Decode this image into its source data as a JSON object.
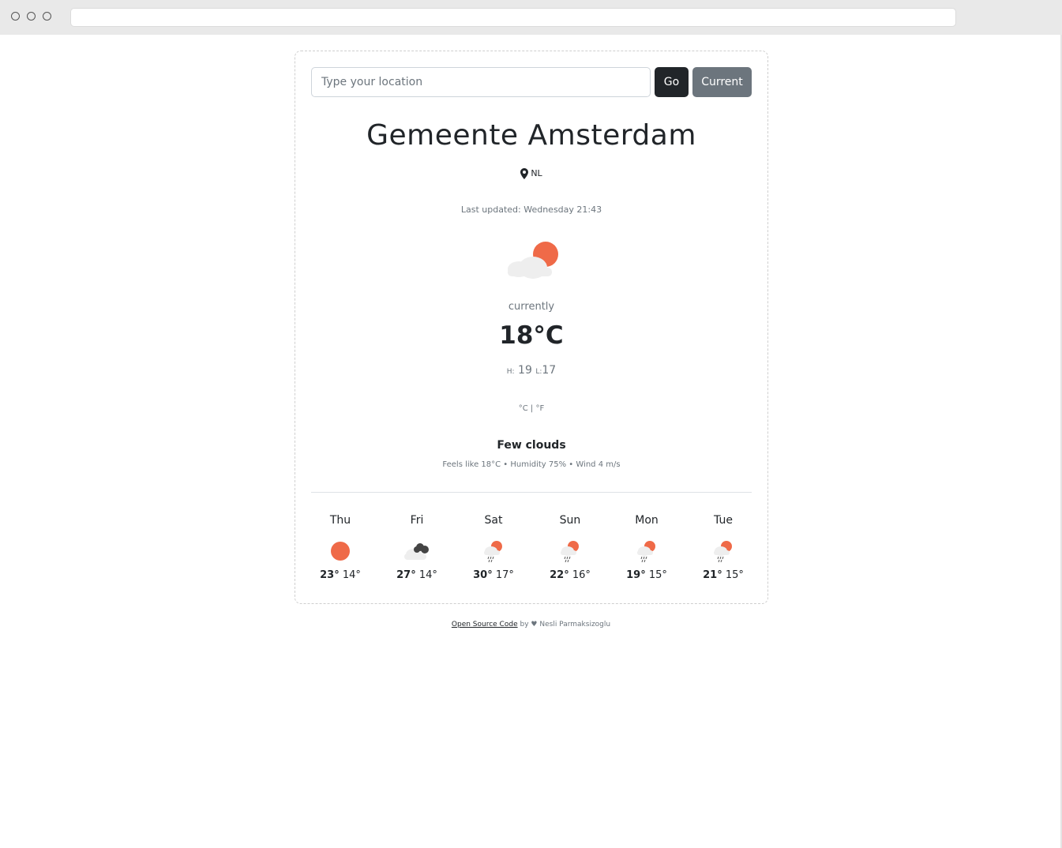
{
  "search": {
    "placeholder": "Type your location",
    "value": ""
  },
  "buttons": {
    "go": "Go",
    "current": "Current"
  },
  "location": {
    "city": "Gemeente Amsterdam",
    "country": "NL"
  },
  "last_updated": "Last updated: Wednesday 21:43",
  "current": {
    "label": "currently",
    "temperature": "18°C",
    "high_label": "H:",
    "high": "19",
    "low_label": "L:",
    "low": "17",
    "icon": "few-clouds-night-icon",
    "condition": "Few clouds",
    "details": "Feels like 18°C • Humidity 75% • Wind 4 m/s"
  },
  "units": {
    "celsius": "°C",
    "separator": "|",
    "fahrenheit": "°F"
  },
  "forecast": [
    {
      "day": "Thu",
      "icon": "sun-icon",
      "high": "23°",
      "low": "14°"
    },
    {
      "day": "Fri",
      "icon": "broken-clouds-icon",
      "high": "27°",
      "low": "14°"
    },
    {
      "day": "Sat",
      "icon": "rain-icon",
      "high": "30°",
      "low": "17°"
    },
    {
      "day": "Sun",
      "icon": "rain-icon",
      "high": "22°",
      "low": "16°"
    },
    {
      "day": "Mon",
      "icon": "rain-icon",
      "high": "19°",
      "low": "15°"
    },
    {
      "day": "Tue",
      "icon": "rain-icon",
      "high": "21°",
      "low": "15°"
    }
  ],
  "footer": {
    "link": "Open Source Code",
    "by": "by",
    "heart": "♥",
    "author": "Nesli Parmaksizoglu"
  },
  "colors": {
    "sun": "#ef6a48",
    "cloud": "#eeeeee",
    "dark": "#212529",
    "muted": "#6c757d"
  }
}
